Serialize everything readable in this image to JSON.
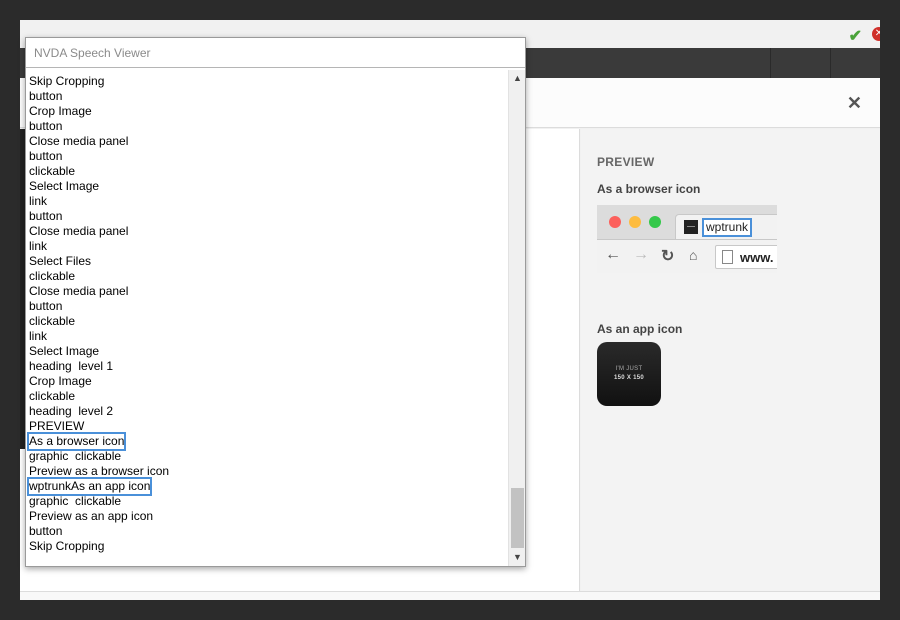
{
  "speech_viewer": {
    "title": "NVDA Speech Viewer",
    "lines": [
      "Skip Cropping",
      "button",
      "Crop Image",
      "button",
      "Close media panel",
      "button",
      "clickable",
      "Select Image",
      "link",
      "button",
      "Close media panel",
      "link",
      "Select Files",
      "clickable",
      "Close media panel",
      "button",
      "clickable",
      "link",
      "Select Image",
      "heading  level 1",
      "Crop Image",
      "clickable",
      "heading  level 2",
      "PREVIEW",
      "As a browser icon",
      "graphic  clickable",
      "Preview as a browser icon",
      "wptrunkAs an app icon",
      "graphic  clickable",
      "Preview as an app icon",
      "button",
      "Skip Cropping"
    ],
    "highlighted_lines": [
      24,
      27
    ]
  },
  "preview": {
    "heading": "PREVIEW",
    "browser_icon_label": "As a browser icon",
    "tab_title": "wptrunk",
    "url_text": "www.",
    "app_icon_label": "As an app icon",
    "app_icon_line1": "I'M JUST",
    "app_icon_line2": "150 X 150"
  },
  "icons": {
    "ok": "checkmark-icon",
    "error": "error-icon",
    "close": "close-icon"
  },
  "colors": {
    "highlight": "#4a90d9",
    "dark_bar": "#3a3a3a"
  }
}
